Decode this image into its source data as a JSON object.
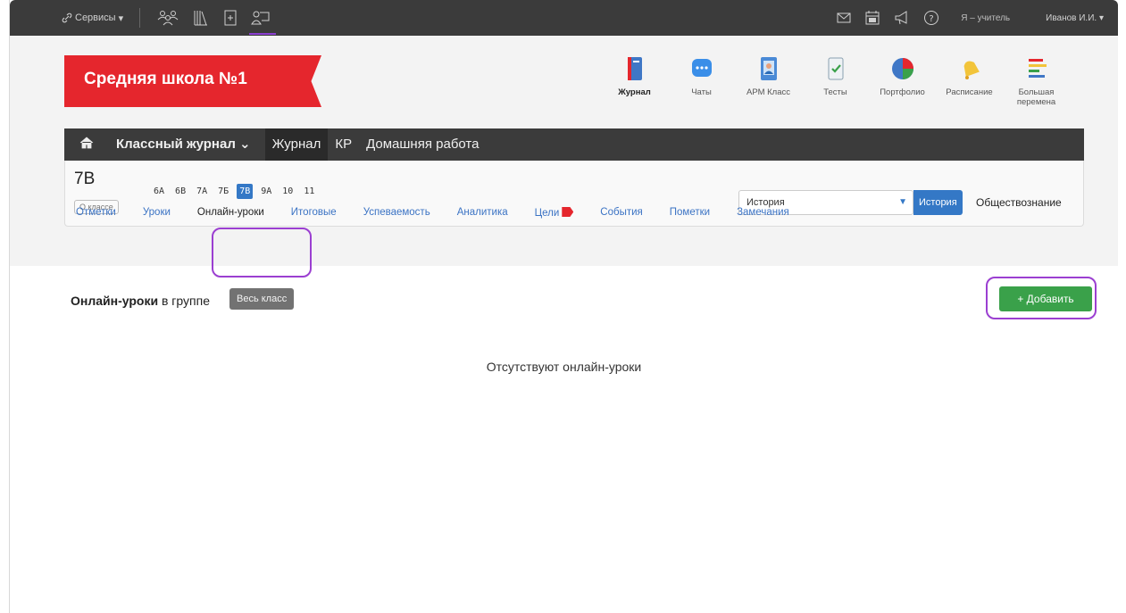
{
  "topbar": {
    "services_label": "Сервисы",
    "role_label": "Я – учитель",
    "user_label": "Иванов И.И.",
    "nav_icons": [
      "people-icon",
      "library-icon",
      "add-document-icon",
      "teacher-icon"
    ],
    "right_icons": [
      "mail-icon",
      "calendar-icon",
      "megaphone-icon",
      "help-icon"
    ]
  },
  "school": {
    "name": "Средняя школа №1"
  },
  "apps": [
    {
      "label": "Журнал",
      "icon": "journal-icon"
    },
    {
      "label": "Чаты",
      "icon": "chat-icon"
    },
    {
      "label": "АРМ Класс",
      "icon": "class-icon"
    },
    {
      "label": "Тесты",
      "icon": "tests-icon"
    },
    {
      "label": "Портфолио",
      "icon": "portfolio-icon"
    },
    {
      "label": "Расписание",
      "icon": "bell-icon"
    },
    {
      "label": "Большая перемена",
      "icon": "big-break-icon"
    }
  ],
  "navbar": {
    "journal_menu": "Классный журнал",
    "items": [
      "Журнал",
      "КР",
      "Домашняя работа"
    ]
  },
  "classinfo": {
    "name": "7В",
    "about_label": "О классе",
    "grades": [
      "6А",
      "6В",
      "7А",
      "7Б",
      "7В",
      "9А",
      "10",
      "11"
    ],
    "active_grade": "7В",
    "subject_select": "История",
    "subject_active": "История",
    "subject_other": "Обществознание"
  },
  "tabs": [
    "Отметки",
    "Уроки",
    "Онлайн-уроки",
    "Итоговые",
    "Успеваемость",
    "Аналитика",
    "Цели",
    "События",
    "Пометки",
    "Замечания"
  ],
  "content": {
    "title_bold": "Онлайн-уроки",
    "title_rest": " в группе",
    "group_button": "Весь класс",
    "add_button": "+ Добавить",
    "empty_message": "Отсутствуют онлайн-уроки"
  },
  "colors": {
    "brand_red": "#e5262d",
    "accent_blue": "#3478c6",
    "add_green": "#3aa14a",
    "highlight_purple": "#9b3fd1"
  }
}
